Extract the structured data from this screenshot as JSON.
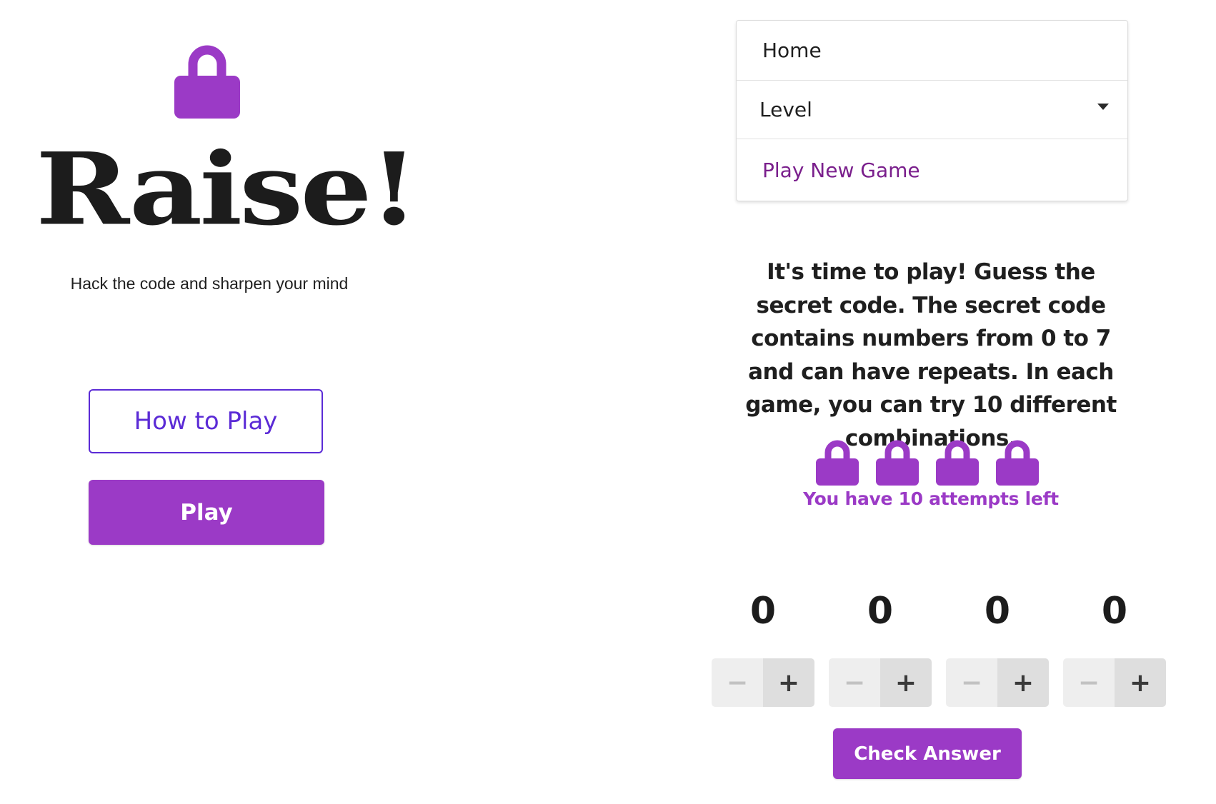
{
  "colors": {
    "accent": "#9b3ac6",
    "outline_button": "#5b2bd6",
    "menu_link": "#7a1f8c"
  },
  "left": {
    "logo_icon": "lock-icon",
    "brand": "Raise!",
    "tagline": "Hack the code and sharpen your mind",
    "how_to_play_label": "How to Play",
    "play_label": "Play"
  },
  "menu": {
    "home_label": "Home",
    "level_label": "Level",
    "level_icon": "caret-down-icon",
    "new_game_label": "Play New Game"
  },
  "game": {
    "instructions": "It's time to play! Guess the secret code. The secret code contains numbers from 0 to 7 and can have repeats. In each game, you can try 10 different combinations.",
    "lock_icon": "lock-icon",
    "attempts_text": "You have 10 attempts left",
    "digits": [
      {
        "value": "0",
        "minus": "−",
        "plus": "+"
      },
      {
        "value": "0",
        "minus": "−",
        "plus": "+"
      },
      {
        "value": "0",
        "minus": "−",
        "plus": "+"
      },
      {
        "value": "0",
        "minus": "−",
        "plus": "+"
      }
    ],
    "check_label": "Check Answer"
  }
}
